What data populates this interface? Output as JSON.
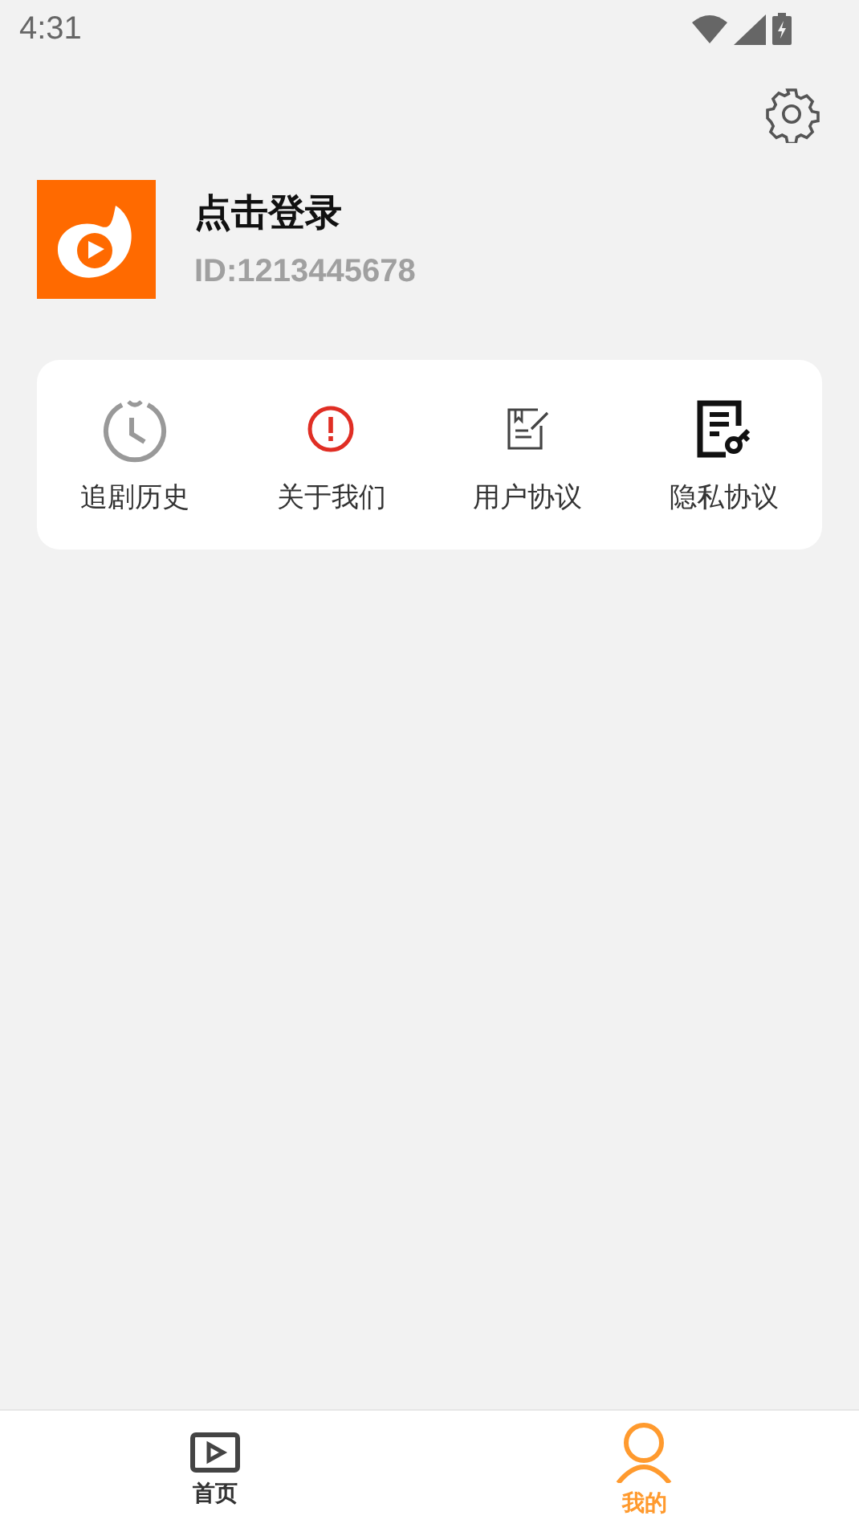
{
  "status_bar": {
    "time": "4:31"
  },
  "profile": {
    "name": "点击登录",
    "id": "ID:1213445678"
  },
  "menu": [
    {
      "kind": "history",
      "label": "追剧历史"
    },
    {
      "kind": "about",
      "label": "关于我们"
    },
    {
      "kind": "agreement",
      "label": "用户协议"
    },
    {
      "kind": "privacy",
      "label": "隐私协议"
    }
  ],
  "tabs": [
    {
      "kind": "home",
      "label": "首页",
      "selected": false
    },
    {
      "kind": "mine",
      "label": "我的",
      "selected": true
    }
  ]
}
